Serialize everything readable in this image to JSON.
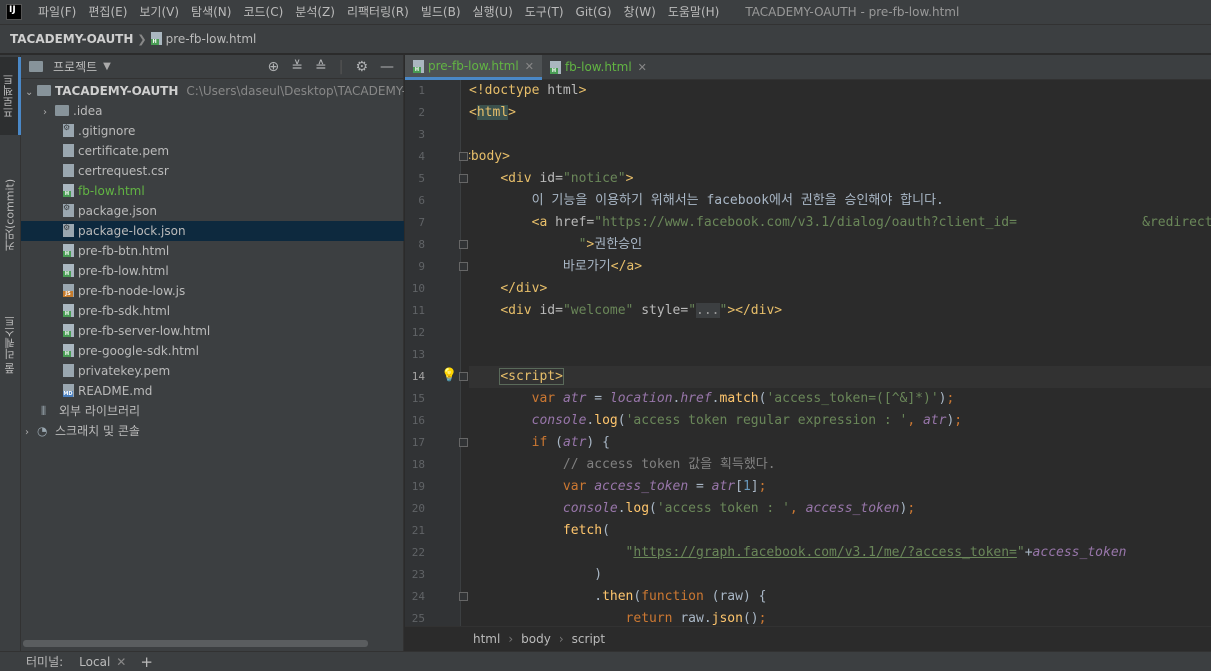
{
  "menubar": {
    "items": [
      "파일(F)",
      "편집(E)",
      "보기(V)",
      "탐색(N)",
      "코드(C)",
      "분석(Z)",
      "리팩터링(R)",
      "빌드(B)",
      "실행(U)",
      "도구(T)",
      "Git(G)",
      "창(W)",
      "도움말(H)"
    ],
    "window_title": "TACADEMY-OAUTH - pre-fb-low.html"
  },
  "breadcrumb": {
    "project": "TACADEMY-OAUTH",
    "file": "pre-fb-low.html"
  },
  "left_stripe": {
    "project": "프로젝트",
    "commit": "커밋(commit)",
    "pull_requests": "풀 리퀘스트"
  },
  "project_panel": {
    "title": "프로젝트",
    "root": {
      "name": "TACADEMY-OAUTH",
      "path": "C:\\Users\\daseul\\Desktop\\TACADEMY-OAUTH"
    },
    "items": [
      {
        "name": ".idea",
        "type": "folder"
      },
      {
        "name": ".gitignore",
        "type": "gear"
      },
      {
        "name": "certificate.pem",
        "type": "file"
      },
      {
        "name": "certrequest.csr",
        "type": "file"
      },
      {
        "name": "fb-low.html",
        "type": "html"
      },
      {
        "name": "package.json",
        "type": "json"
      },
      {
        "name": "package-lock.json",
        "type": "json"
      },
      {
        "name": "pre-fb-btn.html",
        "type": "html"
      },
      {
        "name": "pre-fb-low.html",
        "type": "html"
      },
      {
        "name": "pre-fb-node-low.js",
        "type": "js"
      },
      {
        "name": "pre-fb-sdk.html",
        "type": "html"
      },
      {
        "name": "pre-fb-server-low.html",
        "type": "html"
      },
      {
        "name": "pre-google-sdk.html",
        "type": "html"
      },
      {
        "name": "privatekey.pem",
        "type": "file"
      },
      {
        "name": "README.md",
        "type": "md"
      }
    ],
    "external_libs": "외부 라이브러리",
    "scratches": "스크래치 및 콘솔"
  },
  "editor": {
    "tabs": [
      {
        "label": "pre-fb-low.html"
      },
      {
        "label": "fb-low.html"
      }
    ],
    "line_numbers": [
      "1",
      "2",
      "3",
      "4",
      "5",
      "6",
      "7",
      "8",
      "9",
      "10",
      "11",
      "12",
      "13",
      "14",
      "15",
      "16",
      "17",
      "18",
      "19",
      "20",
      "21",
      "22",
      "23",
      "24",
      "25"
    ],
    "current_line": 14
  },
  "status_nav": {
    "items": [
      "html",
      "body",
      "script"
    ]
  },
  "terminal": {
    "label": "터미널:",
    "tab": "Local",
    "add": "+"
  }
}
